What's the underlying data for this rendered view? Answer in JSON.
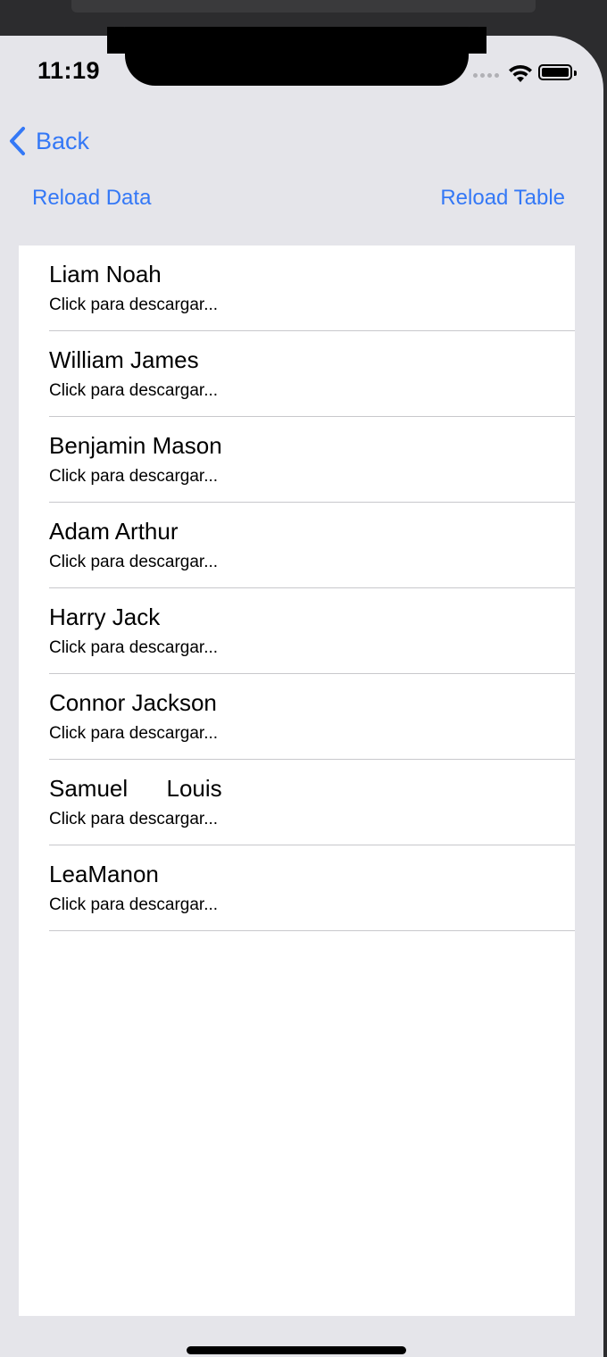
{
  "status_bar": {
    "time": "11:19",
    "wifi_icon": "wifi-icon",
    "battery_icon": "battery-icon",
    "battery_level": 1.0
  },
  "nav": {
    "back_label": "Back",
    "back_icon": "chevron-left-icon"
  },
  "toolbar": {
    "reload_data_label": "Reload Data",
    "reload_table_label": "Reload Table"
  },
  "list": {
    "items": [
      {
        "title": "Liam Noah",
        "subtitle": "Click para descargar..."
      },
      {
        "title": "William James",
        "subtitle": "Click para descargar..."
      },
      {
        "title": "Benjamin Mason",
        "subtitle": "Click para descargar..."
      },
      {
        "title": "Adam Arthur",
        "subtitle": "Click para descargar..."
      },
      {
        "title": "Harry Jack",
        "subtitle": "Click para descargar..."
      },
      {
        "title": "Connor Jackson",
        "subtitle": "Click para descargar..."
      },
      {
        "title": "Samuel      Louis",
        "subtitle": "Click para descargar..."
      },
      {
        "title": "LeaManon",
        "subtitle": "Click para descargar..."
      }
    ]
  },
  "colors": {
    "accent": "#3478f6",
    "background": "#e5e5ea",
    "table_background": "#ffffff",
    "separator": "#c8c8cc"
  }
}
